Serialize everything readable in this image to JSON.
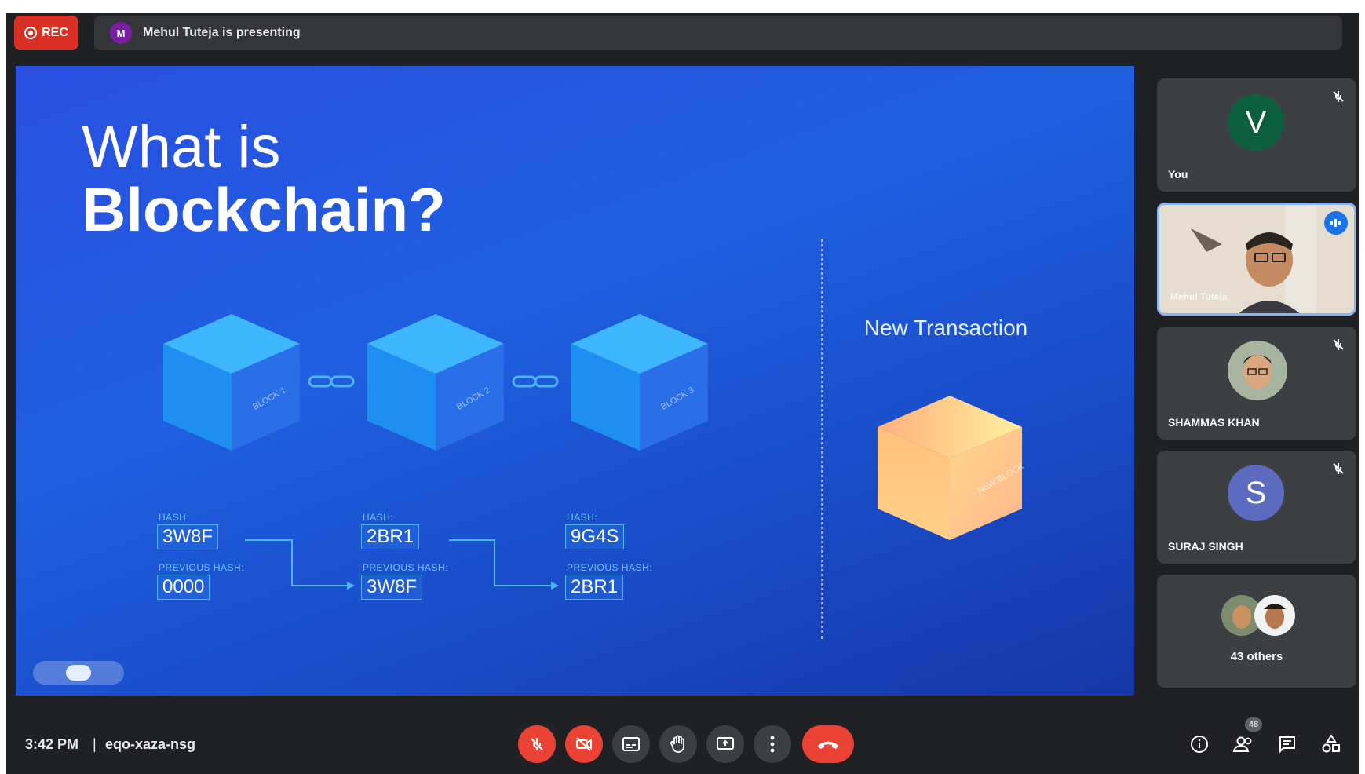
{
  "meeting": {
    "rec_label": "REC",
    "presenter_initial": "M",
    "presenting_text": "Mehul Tuteja is presenting",
    "time": "3:42 PM",
    "separator": "|",
    "meeting_code": "eqo-xaza-nsg"
  },
  "slide": {
    "title_line1": "What is",
    "title_line2": "Blockchain?",
    "blocks": [
      {
        "label": "BLOCK 1",
        "hash_caption": "HASH:",
        "hash": "3W8F",
        "prev_caption": "PREVIOUS HASH:",
        "prev_hash": "0000"
      },
      {
        "label": "BLOCK 2",
        "hash_caption": "HASH:",
        "hash": "2BR1",
        "prev_caption": "PREVIOUS HASH:",
        "prev_hash": "3W8F"
      },
      {
        "label": "BLOCK 3",
        "hash_caption": "HASH:",
        "hash": "9G4S",
        "prev_caption": "PREVIOUS HASH:",
        "prev_hash": "2BR1"
      }
    ],
    "new_transaction": "New Transaction",
    "new_block_label": "NEW BLOCK"
  },
  "participants": [
    {
      "name": "You",
      "initial": "V",
      "color": "#0b5f3c"
    },
    {
      "name": "Mehul Tuteja",
      "speaking": true
    },
    {
      "name": "SHAMMAS KHAN"
    },
    {
      "name": "SURAJ SINGH",
      "initial": "S",
      "color": "#5c6bc0"
    },
    {
      "name": "43 others"
    }
  ],
  "controls": {
    "participant_count": "48",
    "icons": [
      "mic-off-icon",
      "camera-off-icon",
      "captions-icon",
      "raise-hand-icon",
      "present-icon",
      "more-options-icon",
      "end-call-icon",
      "info-icon",
      "people-icon",
      "chat-icon",
      "activities-icon"
    ]
  },
  "colors": {
    "frame_bg": "#202124",
    "tile_bg": "#3c4043",
    "danger": "#ea4335",
    "accent": "#1a73e8"
  }
}
